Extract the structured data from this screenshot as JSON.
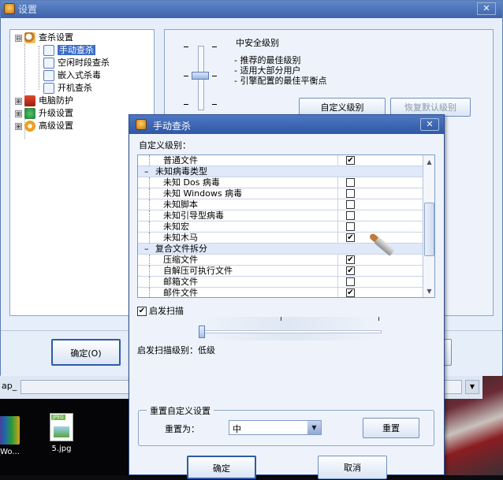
{
  "settings_window": {
    "title": "设置",
    "close_label": "✕",
    "ok_button": "确定(O)",
    "tree": [
      {
        "label": "查杀设置",
        "icon": "magnifier-icon",
        "expander": "⊟"
      },
      {
        "label": "手动查杀",
        "icon": "page-icon"
      },
      {
        "label": "空闲时段查杀",
        "icon": "page-icon"
      },
      {
        "label": "嵌入式杀毒",
        "icon": "page-icon"
      },
      {
        "label": "开机查杀",
        "icon": "page-icon"
      },
      {
        "label": "电脑防护",
        "icon": "shield-icon",
        "expander": "⊞"
      },
      {
        "label": "升级设置",
        "icon": "globe-icon",
        "expander": "⊞"
      },
      {
        "label": "高级设置",
        "icon": "gear-icon",
        "expander": "⊞"
      }
    ],
    "selected_tree_item": "手动查杀",
    "level": {
      "title": "中安全级别",
      "desc": [
        "- 推荐的最佳级别",
        "- 适用大部分用户",
        "- 引擎配置的最佳平衡点"
      ],
      "slider_level": 0.5
    },
    "custom_level_button": "自定义级别",
    "restore_default_button": "恢复默认级别"
  },
  "background_strip": {
    "label": "ap_"
  },
  "desktop": {
    "icons": [
      {
        "label": "_Wo..."
      },
      {
        "label": "5.jpg"
      }
    ]
  },
  "dialog": {
    "title": "手动查杀",
    "close_label": "✕",
    "custom_level_label": "自定义级别：",
    "rows": [
      {
        "type": "item",
        "name": "普通文件",
        "checked": true
      },
      {
        "type": "group",
        "sign": "–",
        "name": "未知病毒类型"
      },
      {
        "type": "item",
        "name": "未知 Dos 病毒",
        "checked": false
      },
      {
        "type": "item",
        "name": "未知 Windows 病毒",
        "checked": false
      },
      {
        "type": "item",
        "name": "未知脚本",
        "checked": false
      },
      {
        "type": "item",
        "name": "未知引导型病毒",
        "checked": false
      },
      {
        "type": "item",
        "name": "未知宏",
        "checked": false
      },
      {
        "type": "item",
        "name": "未知木马",
        "checked": true
      },
      {
        "type": "group",
        "sign": "–",
        "name": "复合文件拆分"
      },
      {
        "type": "item",
        "name": "压缩文件",
        "checked": true
      },
      {
        "type": "item",
        "name": "自解压可执行文件",
        "checked": true
      },
      {
        "type": "item",
        "name": "邮箱文件",
        "checked": false
      },
      {
        "type": "item",
        "name": "邮件文件",
        "checked": true
      }
    ],
    "heuristic_label": "启发扫描",
    "heuristic_checked": true,
    "heuristic_level": 0,
    "heuristic_level_text": "启发扫描级别：低级",
    "reset_group_legend": "重置自定义设置",
    "reset_to_label": "重置为：",
    "reset_select_value": "中",
    "reset_button": "重置",
    "ok_button": "确定",
    "cancel_button": "取消"
  },
  "colors": {
    "titlebar": "#3e63aa",
    "selection": "#3d6ec9",
    "window_bg": "#e6eef9"
  }
}
